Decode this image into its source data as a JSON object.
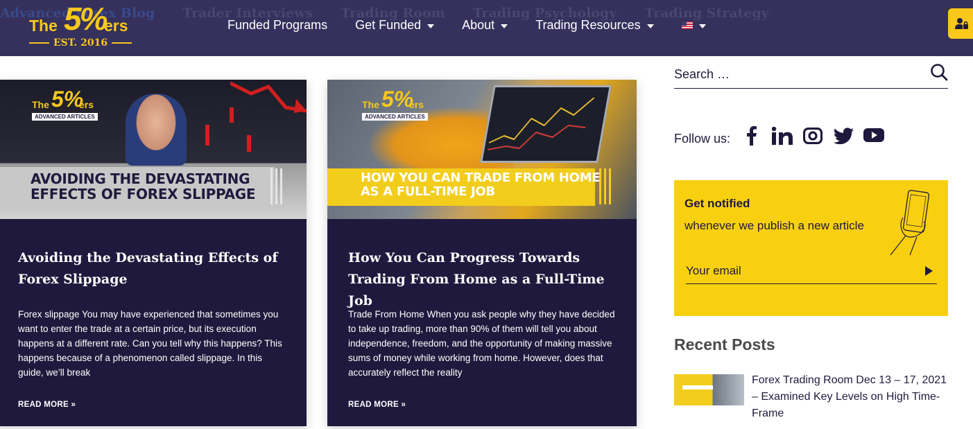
{
  "ghost_nav": [
    "Advanced Forex Blog",
    "Trader Interviews",
    "Trading Room",
    "Trading Psychology",
    "Trading Strategy"
  ],
  "logo": {
    "the": "The",
    "five": "5%",
    "ers": "ers",
    "est": "EST. 2016"
  },
  "nav": {
    "items": [
      {
        "label": "Funded Programs",
        "dropdown": false
      },
      {
        "label": "Get Funded",
        "dropdown": true
      },
      {
        "label": "About",
        "dropdown": true
      },
      {
        "label": "Trading Resources",
        "dropdown": true
      }
    ],
    "language_flag": "us-flag-icon"
  },
  "posts": [
    {
      "thumb_brand": {
        "the": "The",
        "five": "5%",
        "ers": "ers",
        "tag": "ADVANCED ARTICLES"
      },
      "thumb_line1": "AVOIDING THE DEVASTATING",
      "thumb_line2": "EFFECTS OF FOREX SLIPPAGE",
      "title": "Avoiding the Devastating Effects of Forex Slippage",
      "excerpt": "Forex slippage You may have experienced that sometimes you want to enter the trade at a certain price, but its execution happens at a different rate.  Can you tell why this happens? This happens because of a phenomenon called slippage.  In this guide, we’ll break",
      "read_more": "READ MORE »"
    },
    {
      "thumb_brand": {
        "the": "The",
        "five": "5%",
        "ers": "ers",
        "tag": "ADVANCED ARTICLES"
      },
      "thumb_line1": "HOW YOU CAN TRADE FROM HOME",
      "thumb_line2": "AS A FULL-TIME JOB",
      "title": "How You Can Progress Towards Trading From Home as a Full-Time Job",
      "excerpt": "Trade From Home When you ask people why they have decided to take up trading, more than 90% of them will tell you about independence, freedom, and the opportunity of making massive sums of money while working from home. However, does that accurately reflect the reality",
      "read_more": "READ MORE »"
    }
  ],
  "sidebar": {
    "search": {
      "placeholder": "Search …"
    },
    "follow_label": "Follow us:",
    "social_icons": [
      "facebook-icon",
      "linkedin-icon",
      "instagram-icon",
      "twitter-icon",
      "youtube-icon"
    ],
    "notify": {
      "title": "Get notified",
      "subtitle": "whenever we publish a new article",
      "email_placeholder": "Your email"
    },
    "recent_heading": "Recent Posts",
    "recent_posts": [
      {
        "title": "Forex Trading Room Dec 13 – 17, 2021 – Examined Key Levels on High Time-Frame"
      }
    ]
  },
  "colors": {
    "header_bg": "#35305c",
    "brand_yellow": "#f8c81b",
    "card_bg": "#1f1a3d",
    "notify_bg": "#f8d00f"
  }
}
